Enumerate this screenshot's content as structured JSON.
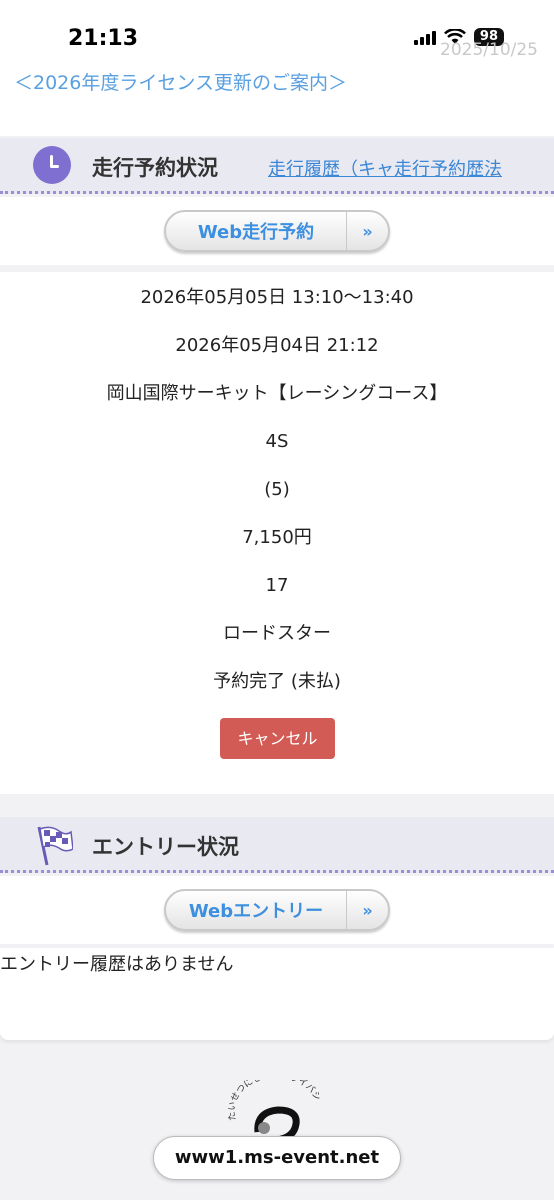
{
  "status": {
    "time": "21:13",
    "battery": "98",
    "ghost_date": "2025/10/25"
  },
  "license_link": "＜2026年度ライセンス更新のご案内＞",
  "reservation": {
    "title": "走行予約状況",
    "history_link": "走行履歴（キャ走行予約歴法",
    "web_button": "Web走行予約",
    "arrow": "»",
    "details": [
      "2026年05月05日 13:10〜13:40",
      "2026年05月04日 21:12",
      "岡山国際サーキット【レーシングコース】",
      "4S",
      "(5)",
      "7,150円",
      "17",
      "ロードスター",
      "予約完了 (未払)"
    ],
    "cancel_button": "キャンセル"
  },
  "entry": {
    "title": "エントリー状況",
    "web_button": "Webエントリー",
    "arrow": "»",
    "empty_message": "エントリー履歴はありません"
  },
  "footer": {
    "logo_text": "たいせつにしますプライバシー",
    "url": "www1.ms-event.net"
  }
}
